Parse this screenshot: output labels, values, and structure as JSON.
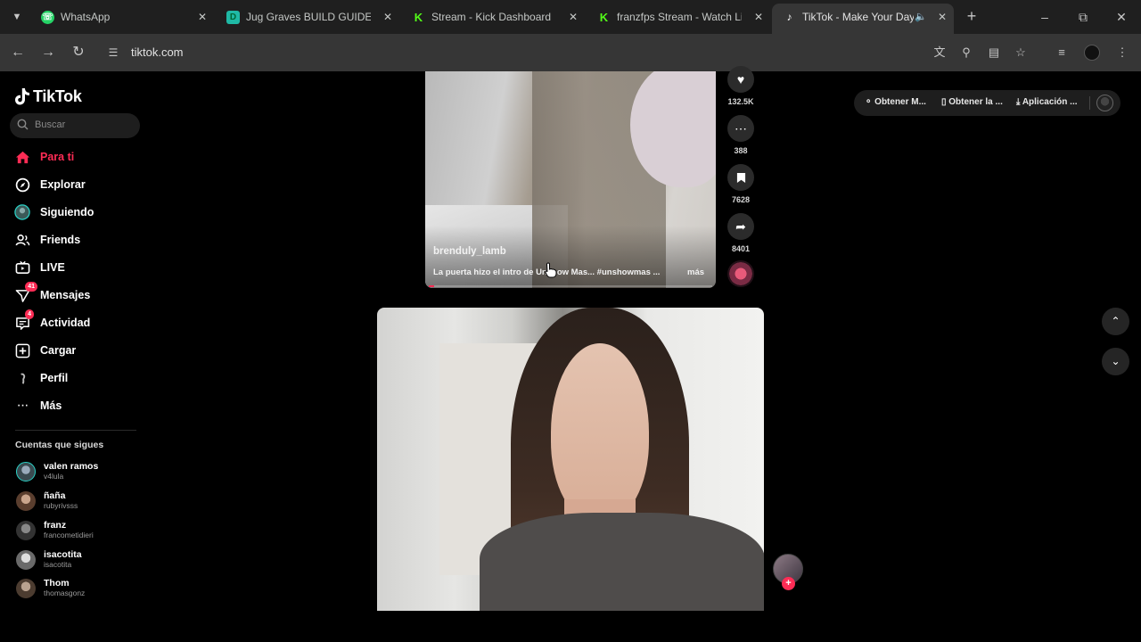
{
  "browser": {
    "tabs": [
      {
        "title": "WhatsApp",
        "favicon": "whatsapp-icon",
        "color": "#25d366"
      },
      {
        "title": "Jug Graves BUILD GUIDE - R",
        "favicon": "d-icon",
        "color": "#1fb9a5"
      },
      {
        "title": "Stream - Kick Dashboard",
        "favicon": "kick-icon",
        "color": "#53fc18"
      },
      {
        "title": "franzfps Stream - Watch Live",
        "favicon": "kick-icon",
        "color": "#53fc18"
      },
      {
        "title": "TikTok - Make Your Day",
        "favicon": "tiktok-icon",
        "color": "#ffffff",
        "active": true
      }
    ],
    "url": "tiktok.com"
  },
  "sidebar": {
    "logo": "TikTok",
    "search_placeholder": "Buscar",
    "nav": [
      {
        "label": "Para ti",
        "icon": "home-icon",
        "active": true
      },
      {
        "label": "Explorar",
        "icon": "compass-icon"
      },
      {
        "label": "Siguiendo",
        "icon": "following-avatar-icon"
      },
      {
        "label": "Friends",
        "icon": "friends-icon"
      },
      {
        "label": "LIVE",
        "icon": "live-tv-icon"
      },
      {
        "label": "Mensajes",
        "icon": "paper-plane-icon",
        "badge": "41"
      },
      {
        "label": "Actividad",
        "icon": "inbox-icon",
        "badge": "4"
      },
      {
        "label": "Cargar",
        "icon": "upload-plus-icon"
      },
      {
        "label": "Perfil",
        "icon": "profile-avatar-icon"
      },
      {
        "label": "Más",
        "icon": "more-dots-icon"
      }
    ],
    "following_title": "Cuentas que sigues",
    "following": [
      {
        "name": "valen ramos",
        "user": "v4lula"
      },
      {
        "name": "ñaña",
        "user": "rubyrivsss"
      },
      {
        "name": "franz",
        "user": "francometidieri"
      },
      {
        "name": "isacotita",
        "user": "isacotita"
      },
      {
        "name": "Thom",
        "user": "thomasgonz"
      }
    ]
  },
  "video1": {
    "username": "brenduly_lamb",
    "description": "La puerta hizo el intro de Unshow Mas... #unshowmas ...",
    "more": "más",
    "progress": 0.02,
    "likes": "132.5K",
    "comments": "388",
    "saves": "7628",
    "shares": "8401"
  },
  "topbar": {
    "pills": [
      "Obtener M...",
      "Obtener la ...",
      "Aplicación ..."
    ]
  },
  "colors": {
    "accent": "#fe2c55",
    "background": "#000000"
  }
}
